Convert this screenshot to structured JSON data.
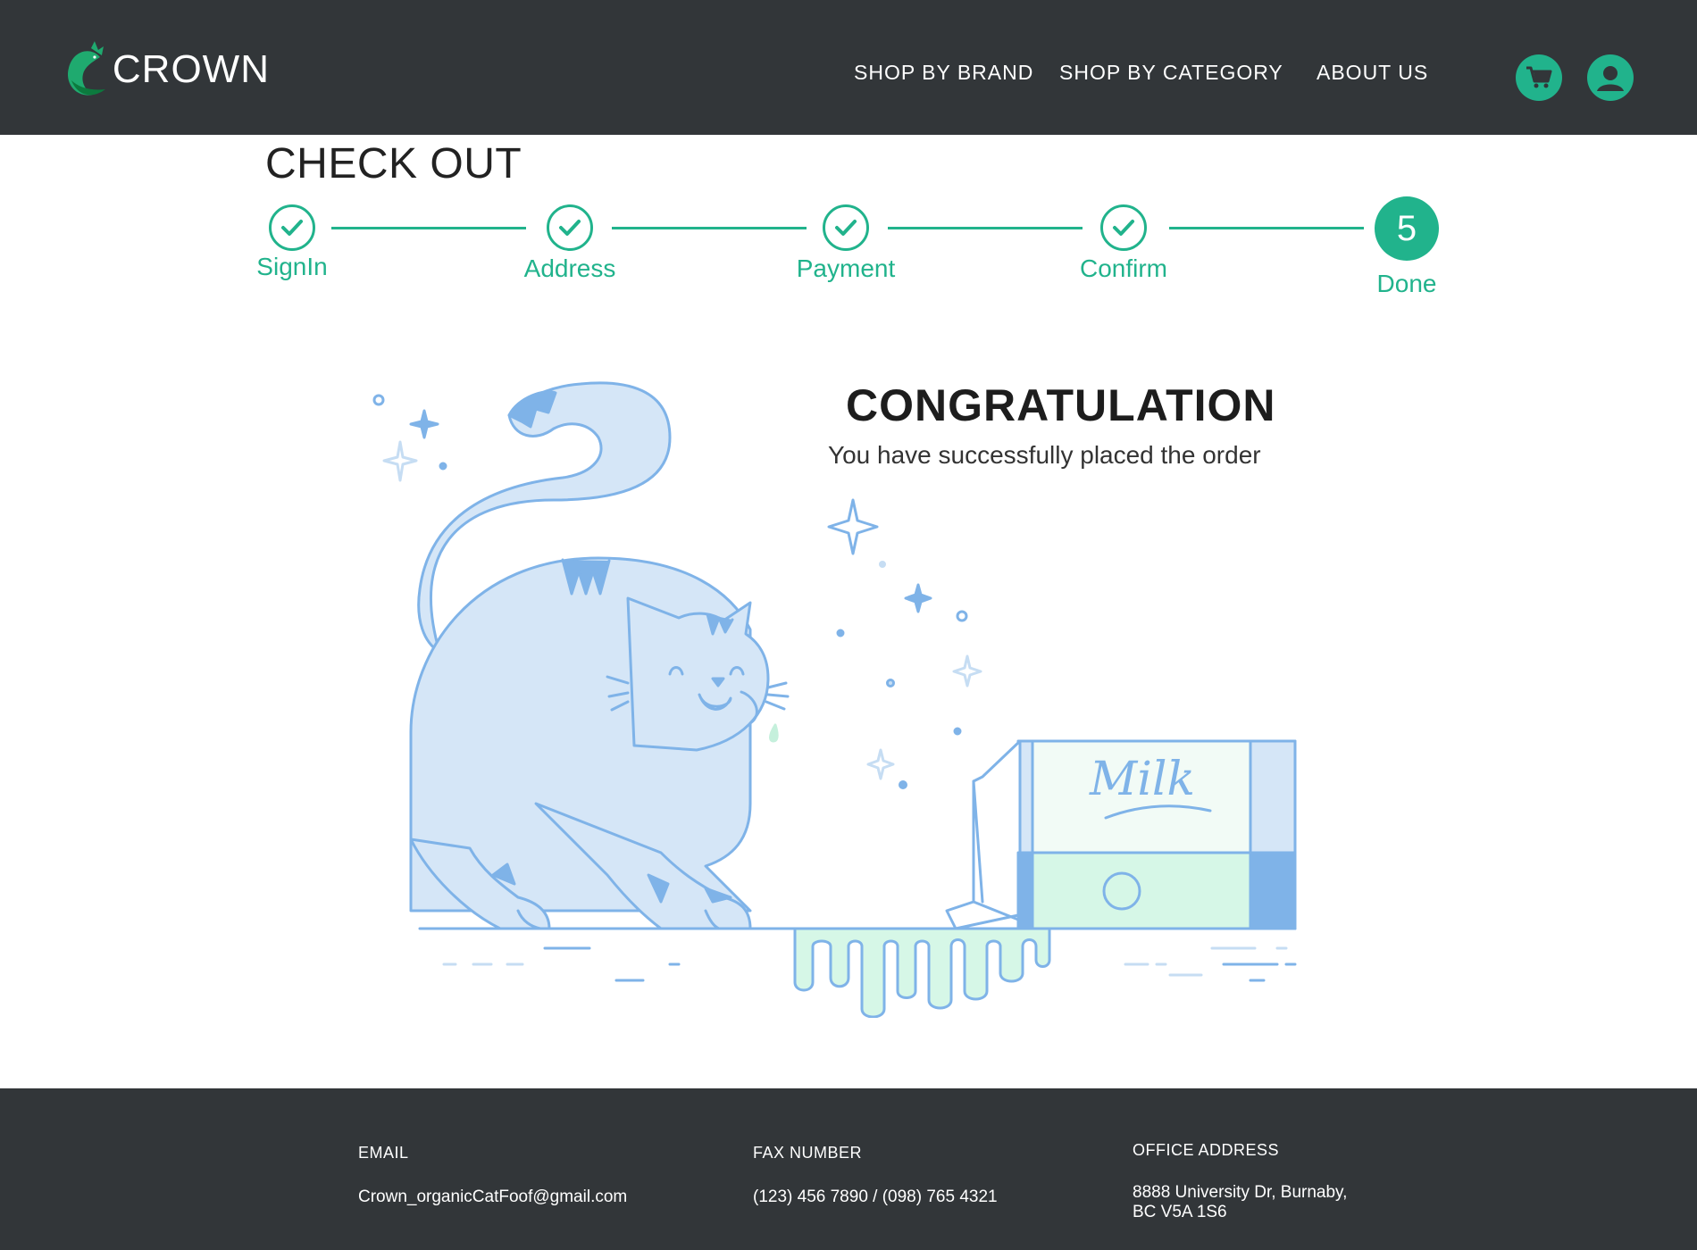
{
  "header": {
    "brand": "CROWN",
    "nav": [
      "SHOP BY BRAND",
      "SHOP BY CATEGORY",
      "ABOUT US"
    ],
    "icons": [
      "cart-icon",
      "user-icon"
    ],
    "accent": "#21b38c",
    "bg": "#323639"
  },
  "checkout": {
    "title": "CHECK OUT",
    "steps": [
      {
        "label": "SignIn",
        "state": "done"
      },
      {
        "label": "Address",
        "state": "done"
      },
      {
        "label": "Payment",
        "state": "done"
      },
      {
        "label": "Confirm",
        "state": "done"
      },
      {
        "label": "Done",
        "number": "5",
        "state": "current"
      }
    ]
  },
  "message": {
    "title": "CONGRATULATION",
    "subtitle": "You have successfully placed the order"
  },
  "illustration": {
    "milk_label": "Milk"
  },
  "footer": {
    "email_label": "EMAIL",
    "email_value": "Crown_organicCatFoof@gmail.com",
    "fax_label": "FAX NUMBER",
    "fax_value": "(123) 456 7890 / (098) 765 4321",
    "address_label": "OFFICE ADDRESS",
    "address_line1": "8888 University Dr, Burnaby,",
    "address_line2": "BC V5A 1S6"
  }
}
